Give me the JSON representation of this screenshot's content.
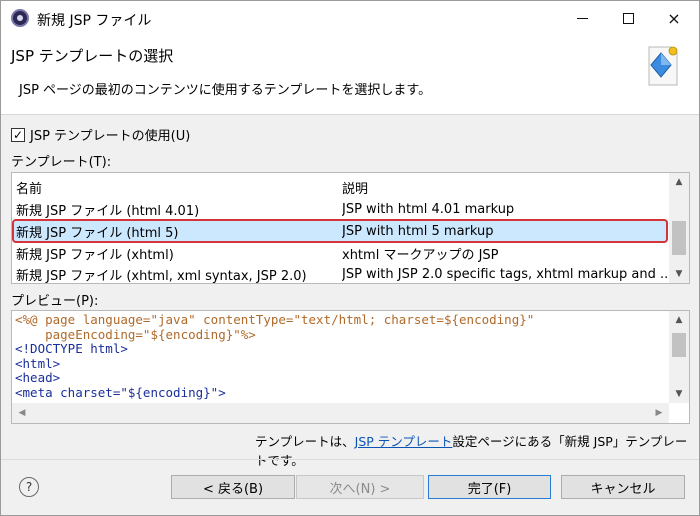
{
  "window": {
    "title": "新規 JSP ファイル",
    "controls": {
      "minimize": "minimize-icon",
      "maximize": "maximize-icon",
      "close": "×"
    }
  },
  "banner": {
    "title": "JSP テンプレートの選択",
    "description": "JSP ページの最初のコンテンツに使用するテンプレートを選択します。",
    "icon": "wizard-diamond-icon"
  },
  "use_template": {
    "checked": true,
    "check_mark": "✓",
    "label": "JSP テンプレートの使用(U)"
  },
  "templates_label": "テンプレート(T):",
  "table": {
    "columns": [
      "名前",
      "説明"
    ],
    "rows": [
      {
        "name": "新規 JSP ファイル (html 4.01)",
        "desc": "JSP with html 4.01 markup"
      },
      {
        "name": "新規 JSP ファイル (html 5)",
        "desc": "JSP with html 5 markup"
      },
      {
        "name": "新規 JSP ファイル (xhtml)",
        "desc": "xhtml マークアップの JSP"
      },
      {
        "name": "新規 JSP ファイル (xhtml, xml syntax, JSP 2.0)",
        "desc": "JSP with JSP 2.0 specific tags, xhtml markup and ..."
      }
    ],
    "selected_index": 1,
    "selection_color": "#cce8ff",
    "highlight_color": "#d6343b"
  },
  "preview_label": "プレビュー(P):",
  "preview": {
    "lines": [
      "<%@ page language=\"java\" contentType=\"text/html; charset=${encoding}\"",
      "    pageEncoding=\"${encoding}\"%>",
      "<!DOCTYPE html>",
      "<html>",
      "<head>",
      "<meta charset=\"${encoding}\">"
    ]
  },
  "footer_note": {
    "before": "テンプレートは、",
    "link": "JSP テンプレート",
    "after": "設定ページにある「新規 JSP」テンプレートです。"
  },
  "buttons": {
    "help": "?",
    "back": "< 戻る(B)",
    "next": "次へ(N) >",
    "finish": "完了(F)",
    "cancel": "キャンセル"
  }
}
